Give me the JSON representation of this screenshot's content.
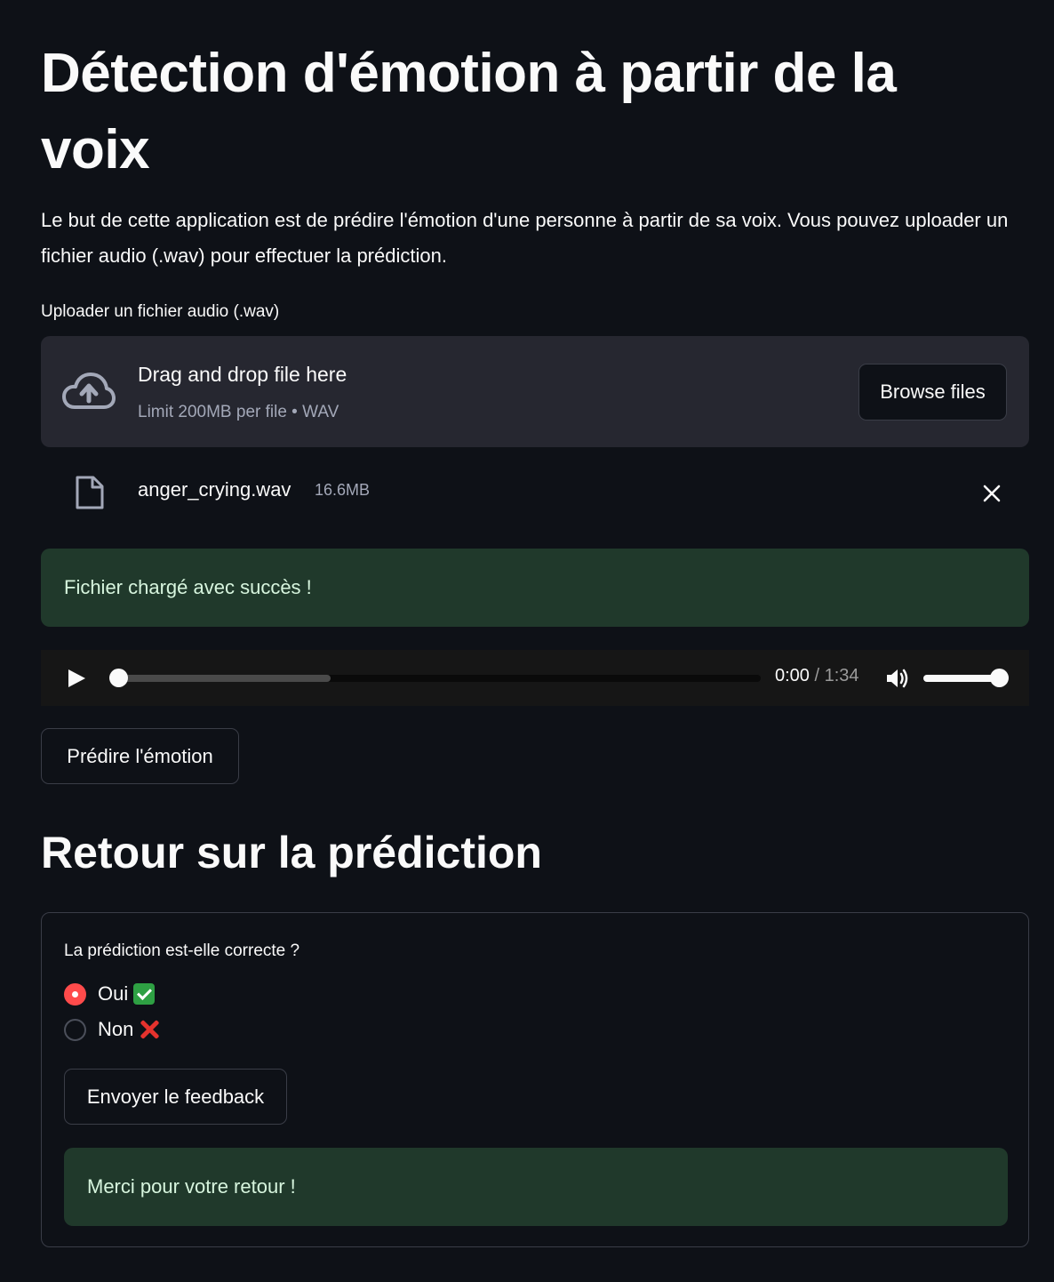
{
  "page": {
    "title": "Détection d'émotion à partir de la voix",
    "intro": "Le but de cette application est de prédire l'émotion d'une personne à partir de sa voix. Vous pouvez uploader un fichier audio (.wav) pour effectuer la prédiction."
  },
  "uploader": {
    "label": "Uploader un fichier audio (.wav)",
    "drop_text": "Drag and drop file here",
    "limit_text": "Limit 200MB per file • WAV",
    "browse_label": "Browse files",
    "icon": "cloud-upload-icon"
  },
  "file": {
    "name": "anger_crying.wav",
    "size": "16.6MB",
    "icon": "file-icon",
    "remove_icon": "close-icon"
  },
  "upload_success": "Fichier chargé avec succès !",
  "audio_player": {
    "current_time": "0:00",
    "separator": " / ",
    "duration": "1:34",
    "progress": 0.0,
    "buffered": 0.33,
    "volume": 1.0
  },
  "predict_button": "Prédire l'émotion",
  "feedback": {
    "section_title": "Retour sur la prédiction",
    "question": "La prédiction est-elle correcte ?",
    "options": [
      {
        "label": "Oui",
        "emoji": "check-mark-emoji",
        "selected": true
      },
      {
        "label": "Non",
        "emoji": "cross-mark-emoji",
        "selected": false
      }
    ],
    "submit_label": "Envoyer le feedback",
    "thanks": "Merci pour votre retour !"
  },
  "colors": {
    "background": "#0e1117",
    "panel": "#262730",
    "success_bg": "#20392b",
    "accent": "#ff4b4b"
  }
}
